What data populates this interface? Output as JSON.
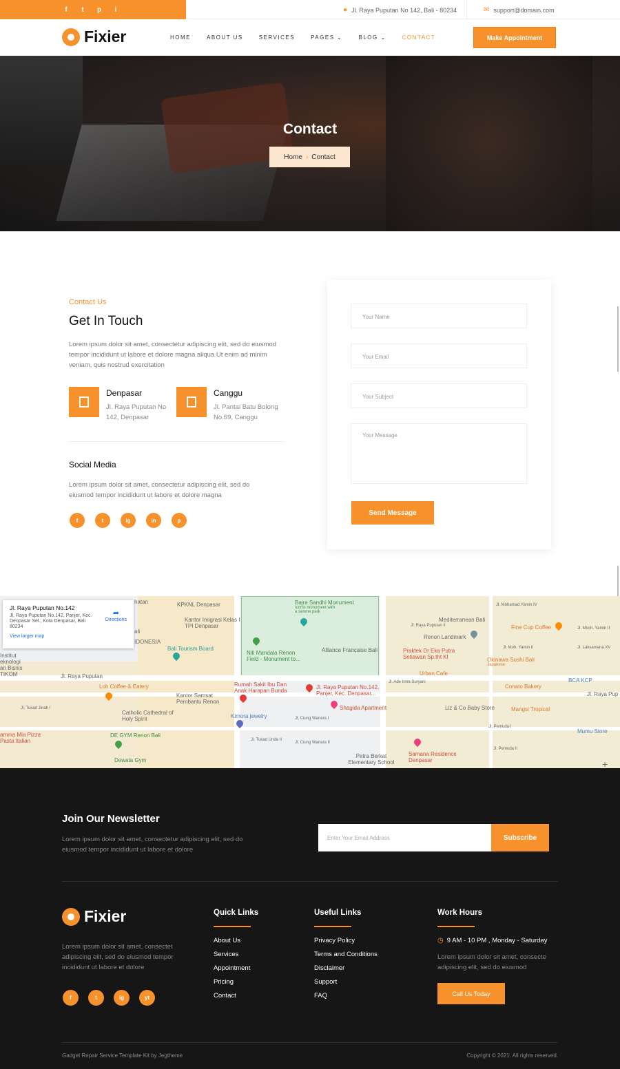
{
  "topbar": {
    "social": [
      "f",
      "t",
      "p",
      "i"
    ],
    "address": "Jl. Raya Puputan No 142, Bali - 80234",
    "email": "support@domain.com"
  },
  "nav": {
    "logo": "Fixier",
    "items": [
      {
        "label": "HOME"
      },
      {
        "label": "ABOUT US"
      },
      {
        "label": "SERVICES"
      },
      {
        "label": "PAGES",
        "dropdown": true
      },
      {
        "label": "BLOG",
        "dropdown": true
      },
      {
        "label": "CONTACT",
        "active": true
      }
    ],
    "cta": "Make Appointment"
  },
  "hero": {
    "title": "Contact",
    "crumb_home": "Home",
    "crumb_current": "Contact"
  },
  "info": {
    "eyebrow": "Contact Us",
    "title": "Get In Touch",
    "text": "Lorem ipsum dolor sit amet, consectetur adipiscing elit, sed do eiusmod tempor incididunt ut labore et dolore magna aliqua Ut enim ad minim veniam, quis nostrud exercitation",
    "offices": [
      {
        "name": "Denpasar",
        "address": "Jl. Raya Puputan No 142, Denpasar"
      },
      {
        "name": "Canggu",
        "address": "Jl. Pantai Batu Bolong No.69, Canggu"
      }
    ],
    "social_title": "Social Media",
    "social_text": "Lorem ipsum dolor sit amet, consectetur adipiscing elit, sed do eiusmod tempor incididunt ut labore et dolore magna",
    "social_icons": [
      "f",
      "t",
      "ig",
      "in",
      "p"
    ]
  },
  "form": {
    "name_placeholder": "Your Name",
    "email_placeholder": "Your Email",
    "subject_placeholder": "Your Subject",
    "message_placeholder": "Your Message",
    "submit": "Send Message"
  },
  "map": {
    "card_title": "Jl. Raya Puputan No.142",
    "card_address": "Jl. Raya Puputan No.142, Panjer, Kec. Denpasar Sel., Kota Denpasar, Bali 80234",
    "card_link": "View larger map",
    "directions": "Directions",
    "labels": [
      "KPKNL Denpasar",
      "Kantor Imigrasi Kelas I TPI Denpasar",
      "Bajra Sandhi Monument",
      "Iconic monument with a serene park",
      "Mediterranean Bali",
      "Fine Cup Coffee",
      "Renon Landmark",
      "Bali Tourism Board",
      "Niti Mandala Renon Field - Monument to...",
      "Alliance Française Bali",
      "Praktek Dr Eka Putra Setiawan Sp.tht Kl",
      "Okinawa Sushi Bali",
      "Japanese",
      "Urban Cafe",
      "Conato Bakery",
      "BCA KCP",
      "Loh Coffee & Eatery",
      "Kantor Samsat Pembantu Renon",
      "Rumah Sakit Ibu Dan Anak Harapan Bunda",
      "Jl. Raya Puputan No.142, Panjer, Kec. Denpasar...",
      "Shagida Apartment",
      "Liz & Co Baby Store",
      "Mangsi Tropical",
      "Catholic Cathedral of Holy Spirit",
      "Kimora jewelry",
      "DE GYM Renon Bali",
      "Mumu Store",
      "Samana Residence Denpasar",
      "Petra Berkat Elementary School",
      "Dewata Gym",
      "amma Mia Pizza",
      "Pasta Italian",
      "Jl. Raya Puputan",
      "Jl. Raya Pup",
      "Jl. Tukad Jinah I",
      "Jl. Tukad Unda II",
      "Jl. Ciung Wanara I",
      "Jl. Ciung Wanara II",
      "Jl. Pemuda I",
      "Jl. Pemuda II",
      "Jl. Moh. Yamin II",
      "Jl. Laksamana XV",
      "Jl. Mohamad Yamin IV",
      "Jl. Moch. Yamin II",
      "Jl. Ade Irma Suryani",
      "Jl. Raya Puputan II",
      "Institut",
      "eknologi",
      "an Bisnis",
      "TIKOM",
      "IDONESIA",
      "hatan",
      "ali"
    ]
  },
  "newsletter": {
    "title": "Join Our Newsletter",
    "text": "Lorem ipsum dolor sit amet, consectetur adipiscing elit, sed do eiusmod tempor incididunt ut labore et dolore",
    "placeholder": "Enter Your Email Address",
    "button": "Subscribe"
  },
  "footer": {
    "logo": "Fixier",
    "desc": "Lorem ipsum dolor sit amet, consectet adipiscing elit, sed do eiusmod tempor incididunt ut labore et dolore",
    "social": [
      "f",
      "t",
      "ig",
      "yt"
    ],
    "quick_title": "Quick Links",
    "quick_links": [
      "About Us",
      "Services",
      "Appointment",
      "Pricing",
      "Contact"
    ],
    "useful_title": "Useful Links",
    "useful_links": [
      "Privacy Policy",
      "Terms and Conditions",
      "Disclaimer",
      "Support",
      "FAQ"
    ],
    "hours_title": "Work Hours",
    "hours": "9 AM - 10 PM , Monday - Saturday",
    "hours_text": "Lorem ipsum dolor sit amet, consecte adipiscing elit, sed do eiusmod",
    "call_button": "Call Us Today",
    "bottom_left": "Gadget Repair Service Template Kit by Jegtheme",
    "bottom_right": "Copyright © 2021. All rights reserved."
  }
}
